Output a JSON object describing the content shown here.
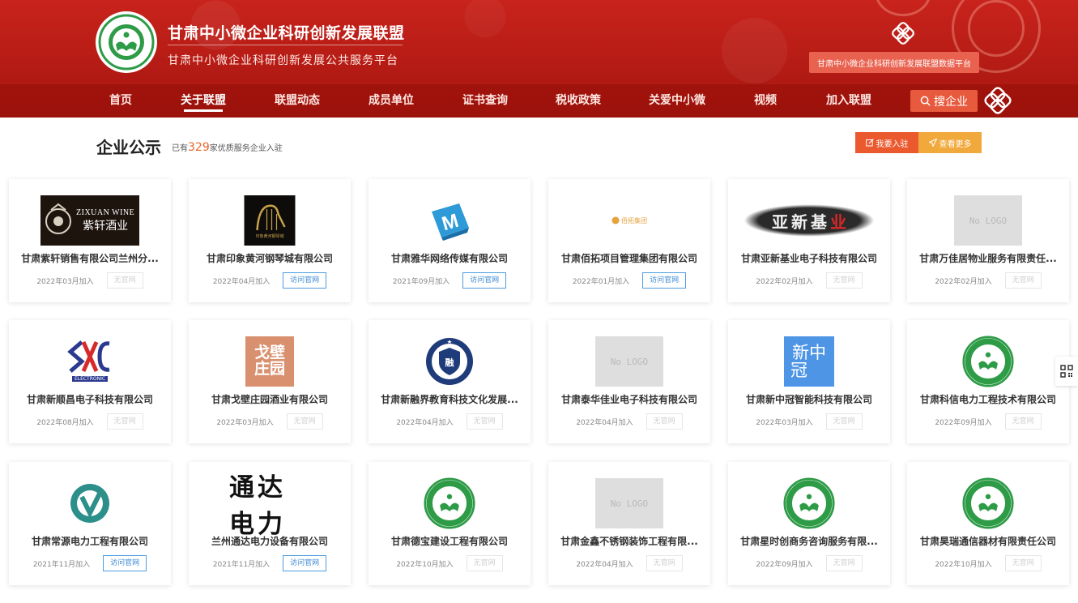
{
  "header": {
    "site_title": "甘肃中小微企业科研创新发展联盟",
    "site_subtitle": "甘肃中小微企业科研创新发展公共服务平台",
    "data_platform_label": "甘肃中小微企业科研创新发展联盟数据平台",
    "search_label": "搜企业",
    "nav": [
      {
        "label": "首页",
        "active": false
      },
      {
        "label": "关于联盟",
        "active": true
      },
      {
        "label": "联盟动态",
        "active": false
      },
      {
        "label": "成员单位",
        "active": false
      },
      {
        "label": "证书查询",
        "active": false
      },
      {
        "label": "税收政策",
        "active": false
      },
      {
        "label": "关爱中小微",
        "active": false
      },
      {
        "label": "视频",
        "active": false
      },
      {
        "label": "加入联盟",
        "active": false
      }
    ]
  },
  "section": {
    "title": "企业公示",
    "sub_prefix": "已有",
    "count": "329",
    "sub_suffix": "家优质服务企业入驻",
    "join_label": "我要入驻",
    "more_label": "查看更多"
  },
  "site_button_label": "访问官网",
  "no_site_label": "无官网",
  "companies": [
    {
      "name": "甘肃紫轩销售有限公司兰州分...",
      "date": "2022年03月加入",
      "has_site": false,
      "logo": "zixuan",
      "logo_text": "ZIXUAN WINE",
      "logo_text2": "紫轩酒业"
    },
    {
      "name": "甘肃印象黄河钢琴城有限公司",
      "date": "2022年04月加入",
      "has_site": true,
      "logo": "piano",
      "logo_text": "印象黄河钢琴城"
    },
    {
      "name": "甘肃雅华网络传媒有限公司",
      "date": "2021年09月加入",
      "has_site": true,
      "logo": "m-cube",
      "logo_text": "M"
    },
    {
      "name": "甘肃佰拓项目管理集团有限公司",
      "date": "2022年01月加入",
      "has_site": true,
      "logo": "baituo",
      "logo_text": "佰拓集团"
    },
    {
      "name": "甘肃亚新基业电子科技有限公司",
      "date": "2022年02月加入",
      "has_site": false,
      "logo": "yaxin",
      "logo_text": "亚新基业"
    },
    {
      "name": "甘肃万佳居物业服务有限责任...",
      "date": "2022年02月加入",
      "has_site": false,
      "logo": "nologo",
      "logo_text": "No LOGO"
    },
    {
      "name": "甘肃新顺昌电子科技有限公司",
      "date": "2022年08月加入",
      "has_site": false,
      "logo": "sxc",
      "logo_text": "ELECTRONIC"
    },
    {
      "name": "甘肃戈壁庄园酒业有限公司",
      "date": "2022年03月加入",
      "has_site": false,
      "logo": "gebi",
      "logo_text": "戈壁",
      "logo_text2": "庄园"
    },
    {
      "name": "甘肃新融界教育科技文化发展...",
      "date": "2022年04月加入",
      "has_site": false,
      "logo": "shield",
      "logo_text": "新融界教育"
    },
    {
      "name": "甘肃泰华佳业电子科技有限公司",
      "date": "2022年04月加入",
      "has_site": false,
      "logo": "nologo",
      "logo_text": "No LOGO"
    },
    {
      "name": "甘肃新中冠智能科技有限公司",
      "date": "2022年03月加入",
      "has_site": false,
      "logo": "xzg",
      "logo_text": "新中",
      "logo_text2": "冠"
    },
    {
      "name": "甘肃科信电力工程技术有限公司",
      "date": "2022年09月加入",
      "has_site": false,
      "logo": "alliance",
      "logo_text": ""
    },
    {
      "name": "甘肃常源电力工程有限公司",
      "date": "2021年11月加入",
      "has_site": true,
      "logo": "cy",
      "logo_text": ""
    },
    {
      "name": "兰州通达电力设备有限公司",
      "date": "2021年11月加入",
      "has_site": true,
      "logo": "tongda",
      "logo_text": "通达电力"
    },
    {
      "name": "甘肃德宝建设工程有限公司",
      "date": "2022年10月加入",
      "has_site": false,
      "logo": "alliance",
      "logo_text": ""
    },
    {
      "name": "甘肃金鑫不锈钢装饰工程有限...",
      "date": "2022年04月加入",
      "has_site": false,
      "logo": "nologo",
      "logo_text": "No LOGO"
    },
    {
      "name": "甘肃星时创商务咨询服务有限...",
      "date": "2022年09月加入",
      "has_site": false,
      "logo": "alliance",
      "logo_text": ""
    },
    {
      "name": "甘肃昊瑞通信器材有限责任公司",
      "date": "2022年10月加入",
      "has_site": false,
      "logo": "alliance",
      "logo_text": ""
    }
  ],
  "colors": {
    "header_red": "#b31b14",
    "accent_orange": "#eb5a2f",
    "accent_yellow": "#f2a93b",
    "link_blue": "#3a89d4",
    "alliance_green": "#2e9b47"
  }
}
